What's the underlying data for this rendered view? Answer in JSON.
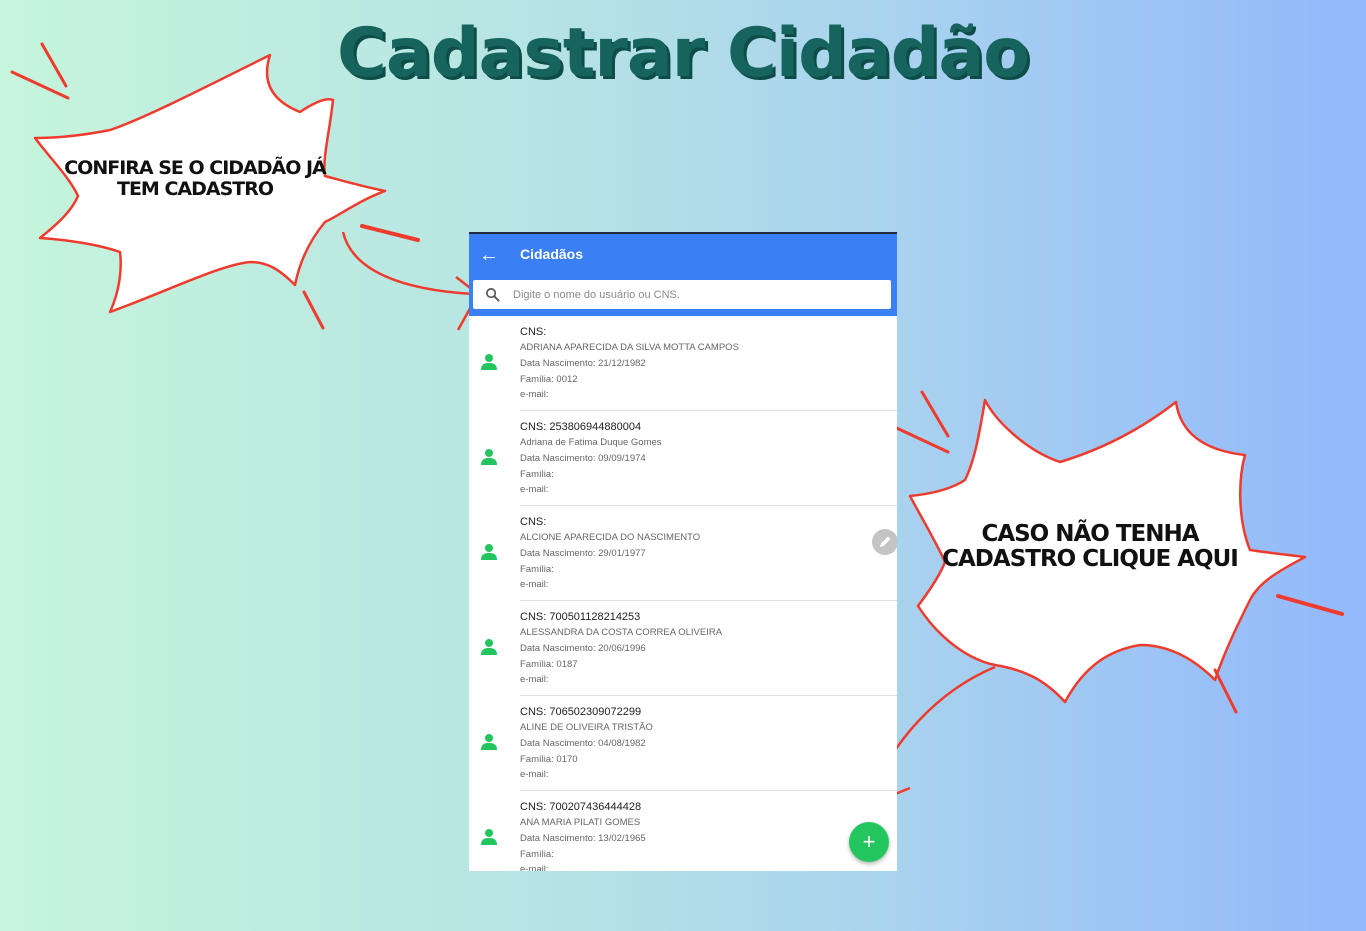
{
  "banner": {
    "title": "Cadastrar Cidadão",
    "callout_search": "Confira se o cidadão já tem cadastro",
    "callout_add": "Caso não tenha cadastro clique aqui"
  },
  "app": {
    "title": "Cidadãos",
    "search_placeholder": "Digite o nome do usuário ou CNS.",
    "fab_label": "+",
    "back_label": "←"
  },
  "citizens": [
    {
      "cns": "CNS:",
      "name": "ADRIANA APARECIDA DA SILVA MOTTA CAMPOS",
      "birth": "Data Nascimento: 21/12/1982",
      "family": "Família: 0012",
      "email": "e-mail:"
    },
    {
      "cns": "CNS: 253806944880004",
      "name": "Adriana de Fatima Duque Gomes",
      "birth": "Data Nascimento: 09/09/1974",
      "family": "Família:",
      "email": "e-mail:"
    },
    {
      "cns": "CNS:",
      "name": "ALCIONE APARECIDA DO NASCIMENTO",
      "birth": "Data Nascimento: 29/01/1977",
      "family": "Família:",
      "email": "e-mail:"
    },
    {
      "cns": "CNS: 700501128214253",
      "name": "ALESSANDRA DA COSTA CORREA OLIVEIRA",
      "birth": "Data Nascimento: 20/06/1996",
      "family": "Família: 0187",
      "email": "e-mail:"
    },
    {
      "cns": "CNS: 706502309072299",
      "name": "ALINE DE OLIVEIRA TRISTÃO",
      "birth": "Data Nascimento: 04/08/1982",
      "family": "Família: 0170",
      "email": "e-mail:"
    },
    {
      "cns": "CNS: 700207436444428",
      "name": "ANA MARIA PILATI GOMES",
      "birth": "Data Nascimento: 13/02/1965",
      "family": "Família:",
      "email": "e-mail:"
    }
  ],
  "colors": {
    "appbar": "#3b7ff5",
    "avatar": "#22c55e",
    "fab": "#22c55e",
    "title": "#17645f",
    "callout_stroke": "#ef3b2d"
  },
  "icons": {
    "back": "arrow-left-icon",
    "search": "search-icon",
    "avatar": "person-icon",
    "edit": "pencil-icon",
    "add": "plus-icon"
  }
}
